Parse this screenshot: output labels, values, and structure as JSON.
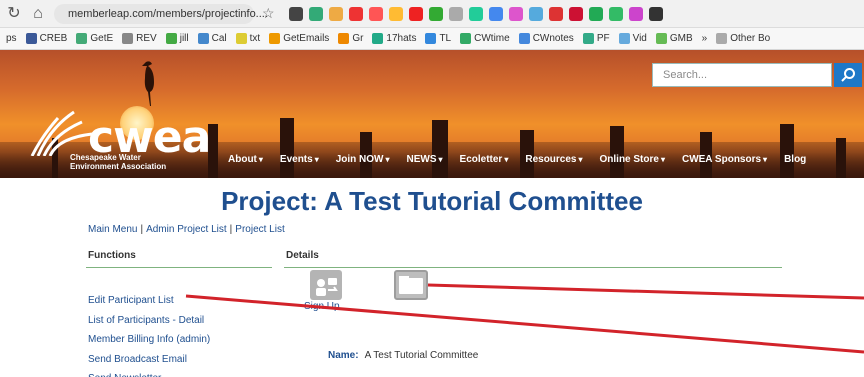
{
  "browser": {
    "url": "memberleap.com/members/projectinfo....",
    "bookmarks": [
      "ps",
      "CREB",
      "GetE",
      "REV",
      "jill",
      "Cal",
      "txt",
      "GetEmails",
      "Gr",
      "17hats",
      "TL",
      "CWtime",
      "CWnotes",
      "PF",
      "Vid",
      "GMB",
      "»",
      "Other Bo"
    ]
  },
  "header": {
    "search_placeholder": "Search...",
    "logo_text": "cwea",
    "logo_sub": "Chesapeake Water\nEnvironment Association",
    "menu": [
      {
        "label": "About",
        "caret": true
      },
      {
        "label": "Events",
        "caret": true
      },
      {
        "label": "Join NOW",
        "caret": true
      },
      {
        "label": "NEWS",
        "caret": true
      },
      {
        "label": "Ecoletter",
        "caret": true
      },
      {
        "label": "Resources",
        "caret": true
      },
      {
        "label": "Online Store",
        "caret": true
      },
      {
        "label": "CWEA Sponsors",
        "caret": true
      },
      {
        "label": "Blog",
        "caret": false
      }
    ]
  },
  "page": {
    "title": "Project: A Test Tutorial Committee",
    "breadcrumb": [
      "Main Menu",
      "Admin Project List",
      "Project List"
    ],
    "functions_heading": "Functions",
    "details_heading": "Details",
    "function_links": [
      "Edit Participant List",
      "List of Participants - Detail",
      "Member Billing Info (admin)",
      "Send Broadcast Email",
      "Send Newsletter"
    ],
    "signup_label": "Sign Up",
    "name_label": "Name:",
    "name_value": "A Test Tutorial Committee"
  },
  "colors": {
    "title_blue": "#1f4f8f",
    "annotation_red": "#d2232a",
    "rule_green": "#7fb37f"
  }
}
